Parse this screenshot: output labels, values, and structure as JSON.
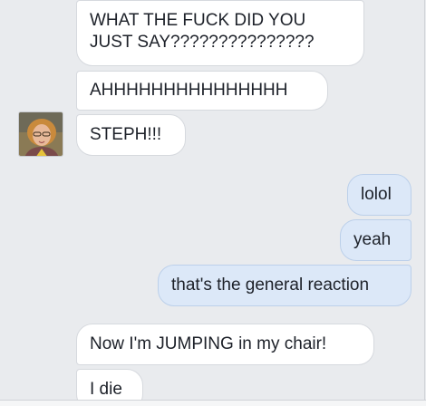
{
  "conversation": {
    "messages": [
      {
        "sender": "other",
        "text_lines": [
          "WHAT THE FUCK DID YOU",
          "JUST SAY???????????????"
        ]
      },
      {
        "sender": "other",
        "text": "AHHHHHHHHHHHHHHH"
      },
      {
        "sender": "other",
        "text": "STEPH!!!"
      },
      {
        "sender": "self",
        "text": "lolol"
      },
      {
        "sender": "self",
        "text": "yeah"
      },
      {
        "sender": "self",
        "text": "that's the general reaction"
      },
      {
        "sender": "other",
        "text": "Now I'm JUMPING in my chair!"
      },
      {
        "sender": "other",
        "text": "I die"
      }
    ]
  },
  "colors": {
    "incoming_bubble": "#ffffff",
    "outgoing_bubble": "#dce8f8",
    "background": "#e9ebee"
  },
  "icons": {
    "avatar": "user-avatar-photo"
  }
}
